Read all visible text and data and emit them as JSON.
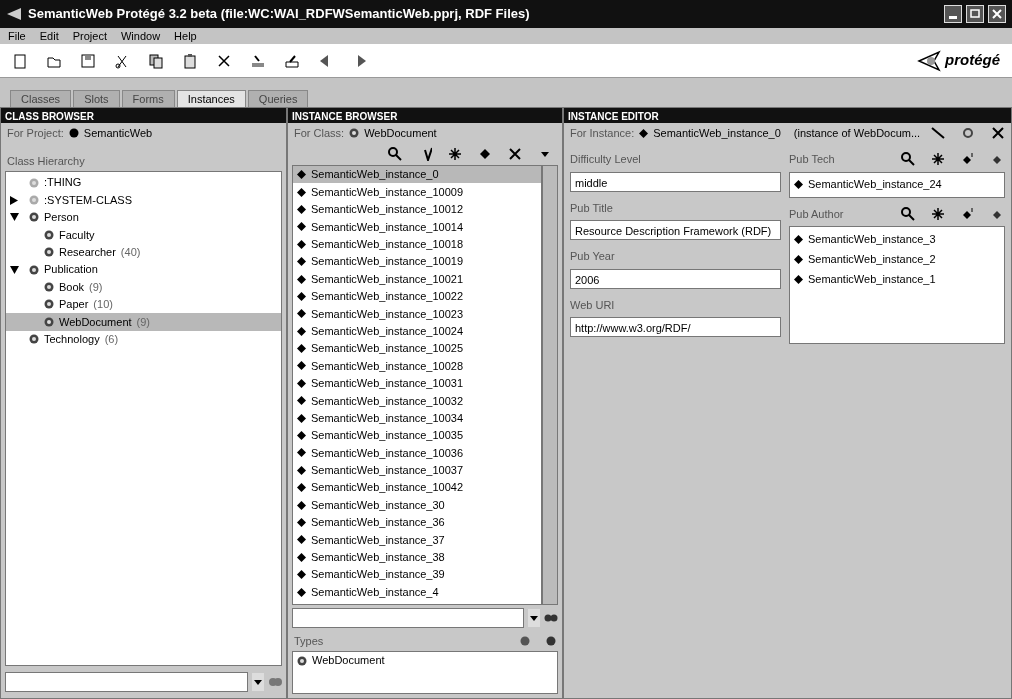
{
  "window": {
    "title": "SemanticWeb  Protégé 3.2 beta    (file:WC:WAI_RDFWSemanticWeb.pprj, RDF Files)"
  },
  "menu": [
    "File",
    "Edit",
    "Project",
    "Window",
    "Help"
  ],
  "logo": "protégé",
  "tabs": [
    {
      "label": "Classes",
      "selected": false
    },
    {
      "label": "Slots",
      "selected": false
    },
    {
      "label": "Forms",
      "selected": false
    },
    {
      "label": "Instances",
      "selected": true
    },
    {
      "label": "Queries",
      "selected": false
    }
  ],
  "class_browser": {
    "title": "CLASS BROWSER",
    "project_label": "For Project:",
    "project": "SemanticWeb",
    "hierarchy_label": "Class Hierarchy",
    "tree": [
      {
        "label": ":THING",
        "kind": "system",
        "selected": false
      },
      {
        "label": ":SYSTEM-CLASS",
        "kind": "system",
        "expanded": false,
        "selected": false
      },
      {
        "label": "Person",
        "kind": "class",
        "expanded": true,
        "selected": false,
        "children": [
          {
            "label": "Faculty",
            "kind": "class",
            "selected": false
          },
          {
            "label": "Researcher",
            "count": "(40)",
            "kind": "class",
            "selected": false
          }
        ]
      },
      {
        "label": "Publication",
        "kind": "class",
        "expanded": true,
        "selected": false,
        "children": [
          {
            "label": "Book",
            "count": "(9)",
            "kind": "class",
            "selected": false
          },
          {
            "label": "Paper",
            "count": "(10)",
            "kind": "class",
            "selected": false
          },
          {
            "label": "WebDocument",
            "count": "(9)",
            "kind": "class",
            "selected": true
          }
        ]
      },
      {
        "label": "Technology",
        "count": "(6)",
        "kind": "class",
        "selected": false
      }
    ]
  },
  "instance_browser": {
    "title": "INSTANCE BROWSER",
    "class_label": "For Class:",
    "class": "WebDocument",
    "instances": [
      {
        "label": "SemanticWeb_instance_0",
        "selected": true
      },
      {
        "label": "SemanticWeb_instance_10009",
        "selected": false
      },
      {
        "label": "SemanticWeb_instance_10012",
        "selected": false
      },
      {
        "label": "SemanticWeb_instance_10014",
        "selected": false
      },
      {
        "label": "SemanticWeb_instance_10018",
        "selected": false
      },
      {
        "label": "SemanticWeb_instance_10019",
        "selected": false
      },
      {
        "label": "SemanticWeb_instance_10021",
        "selected": false
      },
      {
        "label": "SemanticWeb_instance_10022",
        "selected": false
      },
      {
        "label": "SemanticWeb_instance_10023",
        "selected": false
      },
      {
        "label": "SemanticWeb_instance_10024",
        "selected": false
      },
      {
        "label": "SemanticWeb_instance_10025",
        "selected": false
      },
      {
        "label": "SemanticWeb_instance_10028",
        "selected": false
      },
      {
        "label": "SemanticWeb_instance_10031",
        "selected": false
      },
      {
        "label": "SemanticWeb_instance_10032",
        "selected": false
      },
      {
        "label": "SemanticWeb_instance_10034",
        "selected": false
      },
      {
        "label": "SemanticWeb_instance_10035",
        "selected": false
      },
      {
        "label": "SemanticWeb_instance_10036",
        "selected": false
      },
      {
        "label": "SemanticWeb_instance_10037",
        "selected": false
      },
      {
        "label": "SemanticWeb_instance_10042",
        "selected": false
      },
      {
        "label": "SemanticWeb_instance_30",
        "selected": false
      },
      {
        "label": "SemanticWeb_instance_36",
        "selected": false
      },
      {
        "label": "SemanticWeb_instance_37",
        "selected": false
      },
      {
        "label": "SemanticWeb_instance_38",
        "selected": false
      },
      {
        "label": "SemanticWeb_instance_39",
        "selected": false
      },
      {
        "label": "SemanticWeb_instance_4",
        "selected": false
      }
    ],
    "types_label": "Types",
    "types": [
      "WebDocument"
    ]
  },
  "instance_editor": {
    "title": "INSTANCE EDITOR",
    "instance_label": "For Instance:",
    "instance": "SemanticWeb_instance_0",
    "instance_of": "(instance of WebDocum...",
    "fields": [
      {
        "label": "Difficulty Level",
        "value": "middle"
      },
      {
        "label": "Pub Title",
        "value": "Resource Description Framework (RDF)"
      },
      {
        "label": "Pub Year",
        "value": "2006"
      },
      {
        "label": "Web URI",
        "value": "http://www.w3.org/RDF/"
      }
    ],
    "lists": [
      {
        "label": "Pub Tech",
        "items": [
          "SemanticWeb_instance_24"
        ]
      },
      {
        "label": "Pub Author",
        "items": [
          "SemanticWeb_instance_3",
          "SemanticWeb_instance_2",
          "SemanticWeb_instance_1"
        ]
      }
    ]
  }
}
